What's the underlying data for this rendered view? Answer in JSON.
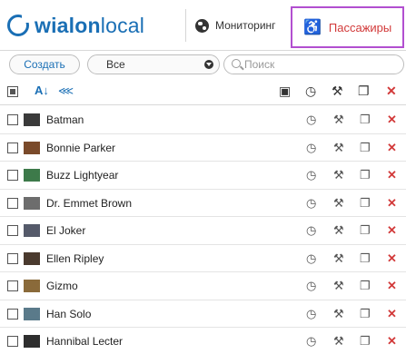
{
  "header": {
    "logo_text_part1": "wialon",
    "logo_text_part2": "local",
    "nav_monitoring_label": "Мониторинг",
    "nav_passengers_label": "Пассажиры"
  },
  "toolbar": {
    "create_label": "Создать",
    "filter_value": "Все",
    "search_placeholder": "Поиск"
  },
  "list": {
    "rows": [
      {
        "name": "Batman",
        "thumb_color": "#3a3a3a"
      },
      {
        "name": "Bonnie Parker",
        "thumb_color": "#7a4a2a"
      },
      {
        "name": "Buzz Lightyear",
        "thumb_color": "#3d7a4a"
      },
      {
        "name": "Dr. Emmet Brown",
        "thumb_color": "#6d6d6d"
      },
      {
        "name": "El Joker",
        "thumb_color": "#555a6a"
      },
      {
        "name": "Ellen Ripley",
        "thumb_color": "#4a3a2e"
      },
      {
        "name": "Gizmo",
        "thumb_color": "#8a6a3a"
      },
      {
        "name": "Han Solo",
        "thumb_color": "#5a7a8a"
      },
      {
        "name": "Hannibal Lecter",
        "thumb_color": "#2e2e2e"
      }
    ]
  },
  "colors": {
    "brand_blue": "#1a6fb5",
    "accent_red": "#d23a3a",
    "highlight_purple": "#b24fd0"
  }
}
